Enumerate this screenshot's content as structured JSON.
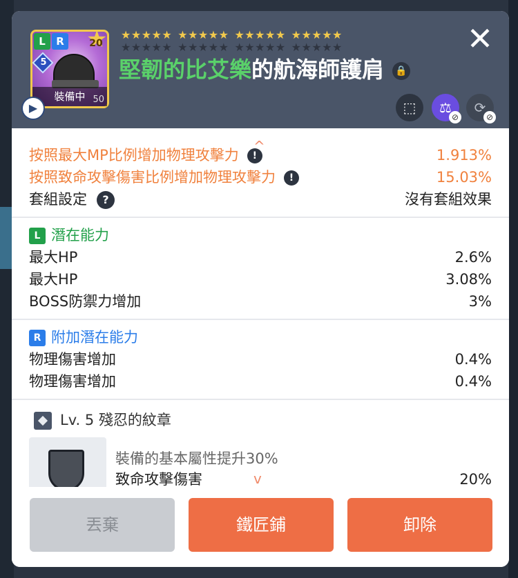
{
  "item": {
    "level_badge": "5",
    "star_force": "20",
    "badge_l": "L",
    "badge_r": "R",
    "equipped_label": "裝備中",
    "equipped_num": "50",
    "title_prefix": "堅韌的比艾樂",
    "title_suffix": "的航海師護肩",
    "stars_filled": 20,
    "stars_total": 40
  },
  "icons": {
    "play": "▶",
    "close": "✕",
    "lock": "🔒",
    "share": "⬚",
    "scale": "⚖",
    "refresh": "⟳",
    "no": "⊘",
    "info": "!",
    "help": "?",
    "up": "^",
    "down": "v"
  },
  "stats_top": [
    {
      "label": "按照最大MP比例增加物理攻擊力",
      "value": "1.913%"
    },
    {
      "label": "按照致命攻擊傷害比例增加物理攻擊力",
      "value": "15.03%"
    },
    {
      "label": "套組設定",
      "value": "沒有套組效果"
    }
  ],
  "potential": {
    "badge": "L",
    "title": "潛在能力",
    "rows": [
      {
        "label": "最大HP",
        "value": "2.6%"
      },
      {
        "label": "最大HP",
        "value": "3.08%"
      },
      {
        "label": "BOSS防禦力增加",
        "value": "3%"
      }
    ]
  },
  "additional": {
    "badge": "R",
    "title": "附加潛在能力",
    "rows": [
      {
        "label": "物理傷害增加",
        "value": "0.4%"
      },
      {
        "label": "物理傷害增加",
        "value": "0.4%"
      }
    ]
  },
  "emblem": {
    "title": "Lv. 5 殘忍的紋章",
    "description": "裝備的基本屬性提升30%",
    "stat_label": "致命攻擊傷害",
    "stat_value": "20%"
  },
  "buttons": {
    "discard": "丟棄",
    "forge": "鐵匠鋪",
    "unequip": "卸除"
  },
  "colors": {
    "header_bg": "#4a5568",
    "accent_orange": "#ee6e45",
    "potential_green": "#22a04a",
    "additional_blue": "#2b7de9"
  }
}
